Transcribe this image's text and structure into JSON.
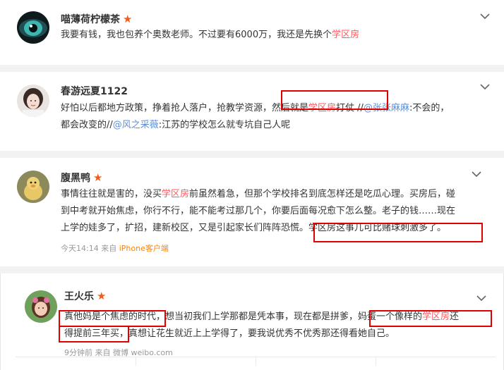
{
  "comments": [
    {
      "username": "喵薄荷柠檬茶",
      "star": "★",
      "lines": [
        [
          "我要有钱，我也包养个奥数老师。不过要有6000万，我还是先换个",
          "学区房"
        ]
      ]
    },
    {
      "username": "春游远夏1122",
      "lines": [
        [
          "好怕以后都地方政策，挣着抢人落户，抢教学资源，然后就是",
          "学区房",
          "打仗 //",
          "@张张麻麻",
          ":不会的，"
        ],
        [
          "都会改变的//",
          "@风之采薇",
          ":江苏的学校怎么就专坑自己人呢"
        ]
      ]
    },
    {
      "username": "腹黑鸭",
      "star": "★",
      "lines": [
        [
          "事情往往就是害的，没买",
          "学区房",
          "前虽然着急，但那个学校排名到底怎样还是吃瓜心理。买房后，碰"
        ],
        [
          "到中考就开始焦虑，你行不行，能不能考过那几个，你要后面每况愈下怎么整。老子的钱……现在"
        ],
        [
          "上学的娃多了，扩招，建新校区，又是引起家长们阵阵恐慌。学区房这事儿可比赌球刺激多了。"
        ]
      ],
      "meta": {
        "time": "今天14:14 来自",
        "source": "iPhone客户端"
      }
    },
    {
      "username": "王火乐",
      "star": "★",
      "lines": [
        [
          "真他妈是个焦虑的时代，想当初我们上学那都是凭本事，现在都是拼爹，妈蛋一个像样的",
          "学区房",
          "还"
        ],
        [
          "得提前三年买，真想让花生就近上上学得了，要我说优秀不优秀那还得看她自己。"
        ]
      ],
      "meta": {
        "time": "9分钟前 来自 微博 weibo.com"
      }
    }
  ],
  "colors": {
    "highlight": "#ff5a5f",
    "link": "#5b8fd9",
    "annotation": "#e00000",
    "vip_star": "#f25c19"
  }
}
